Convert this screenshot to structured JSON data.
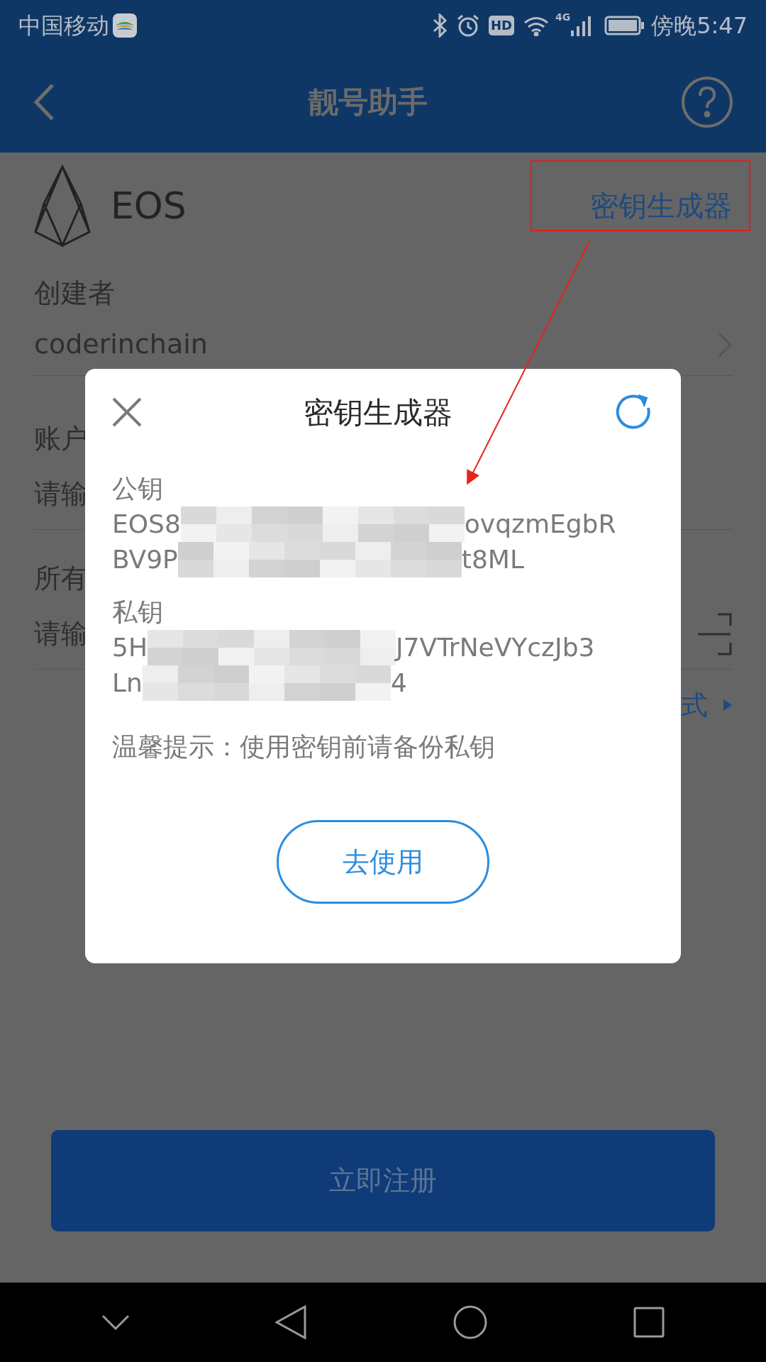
{
  "status_bar": {
    "carrier": "中国移动",
    "hd_badge": "HD",
    "network": "4G",
    "time": "傍晚5:47"
  },
  "header": {
    "title": "靓号助手"
  },
  "token": {
    "name": "EOS"
  },
  "key_generator_link": "密钥生成器",
  "creator": {
    "label": "创建者",
    "value": "coderinchain"
  },
  "account": {
    "label": "账户",
    "placeholder": "请输"
  },
  "owner": {
    "label": "所有",
    "placeholder": "请输"
  },
  "mode_link": "式",
  "register_button": "立即注册",
  "dialog": {
    "title": "密钥生成器",
    "public_key": {
      "label": "公钥",
      "lines": [
        {
          "start": "EOS8",
          "end": "ovqzmEgbR"
        },
        {
          "start": "BV9P",
          "end": "t8ML"
        }
      ]
    },
    "private_key": {
      "label": "私钥",
      "lines": [
        {
          "start": "5H",
          "end": "J7VTrNeVYczJb3"
        },
        {
          "start": "Ln",
          "end": "4"
        }
      ]
    },
    "tip": "温馨提示：使用密钥前请备份私钥",
    "use_button": "去使用"
  }
}
